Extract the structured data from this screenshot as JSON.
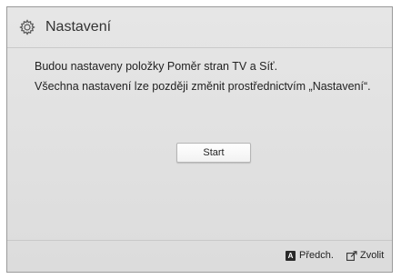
{
  "dialog": {
    "title": "Nastavení",
    "icon": "gear-icon",
    "message_line1": "Budou nastaveny položky Poměr stran TV a Síť.",
    "message_line2": "Všechna nastavení lze později změnit prostřednictvím „Nastavení“.",
    "start_label": "Start"
  },
  "footer": {
    "prev_key": "A",
    "prev_label": "Předch.",
    "select_icon": "enter-icon",
    "select_label": "Zvolit"
  },
  "colors": {
    "background": "#e2e2e2",
    "border": "#9a9a9a",
    "text": "#222222"
  }
}
